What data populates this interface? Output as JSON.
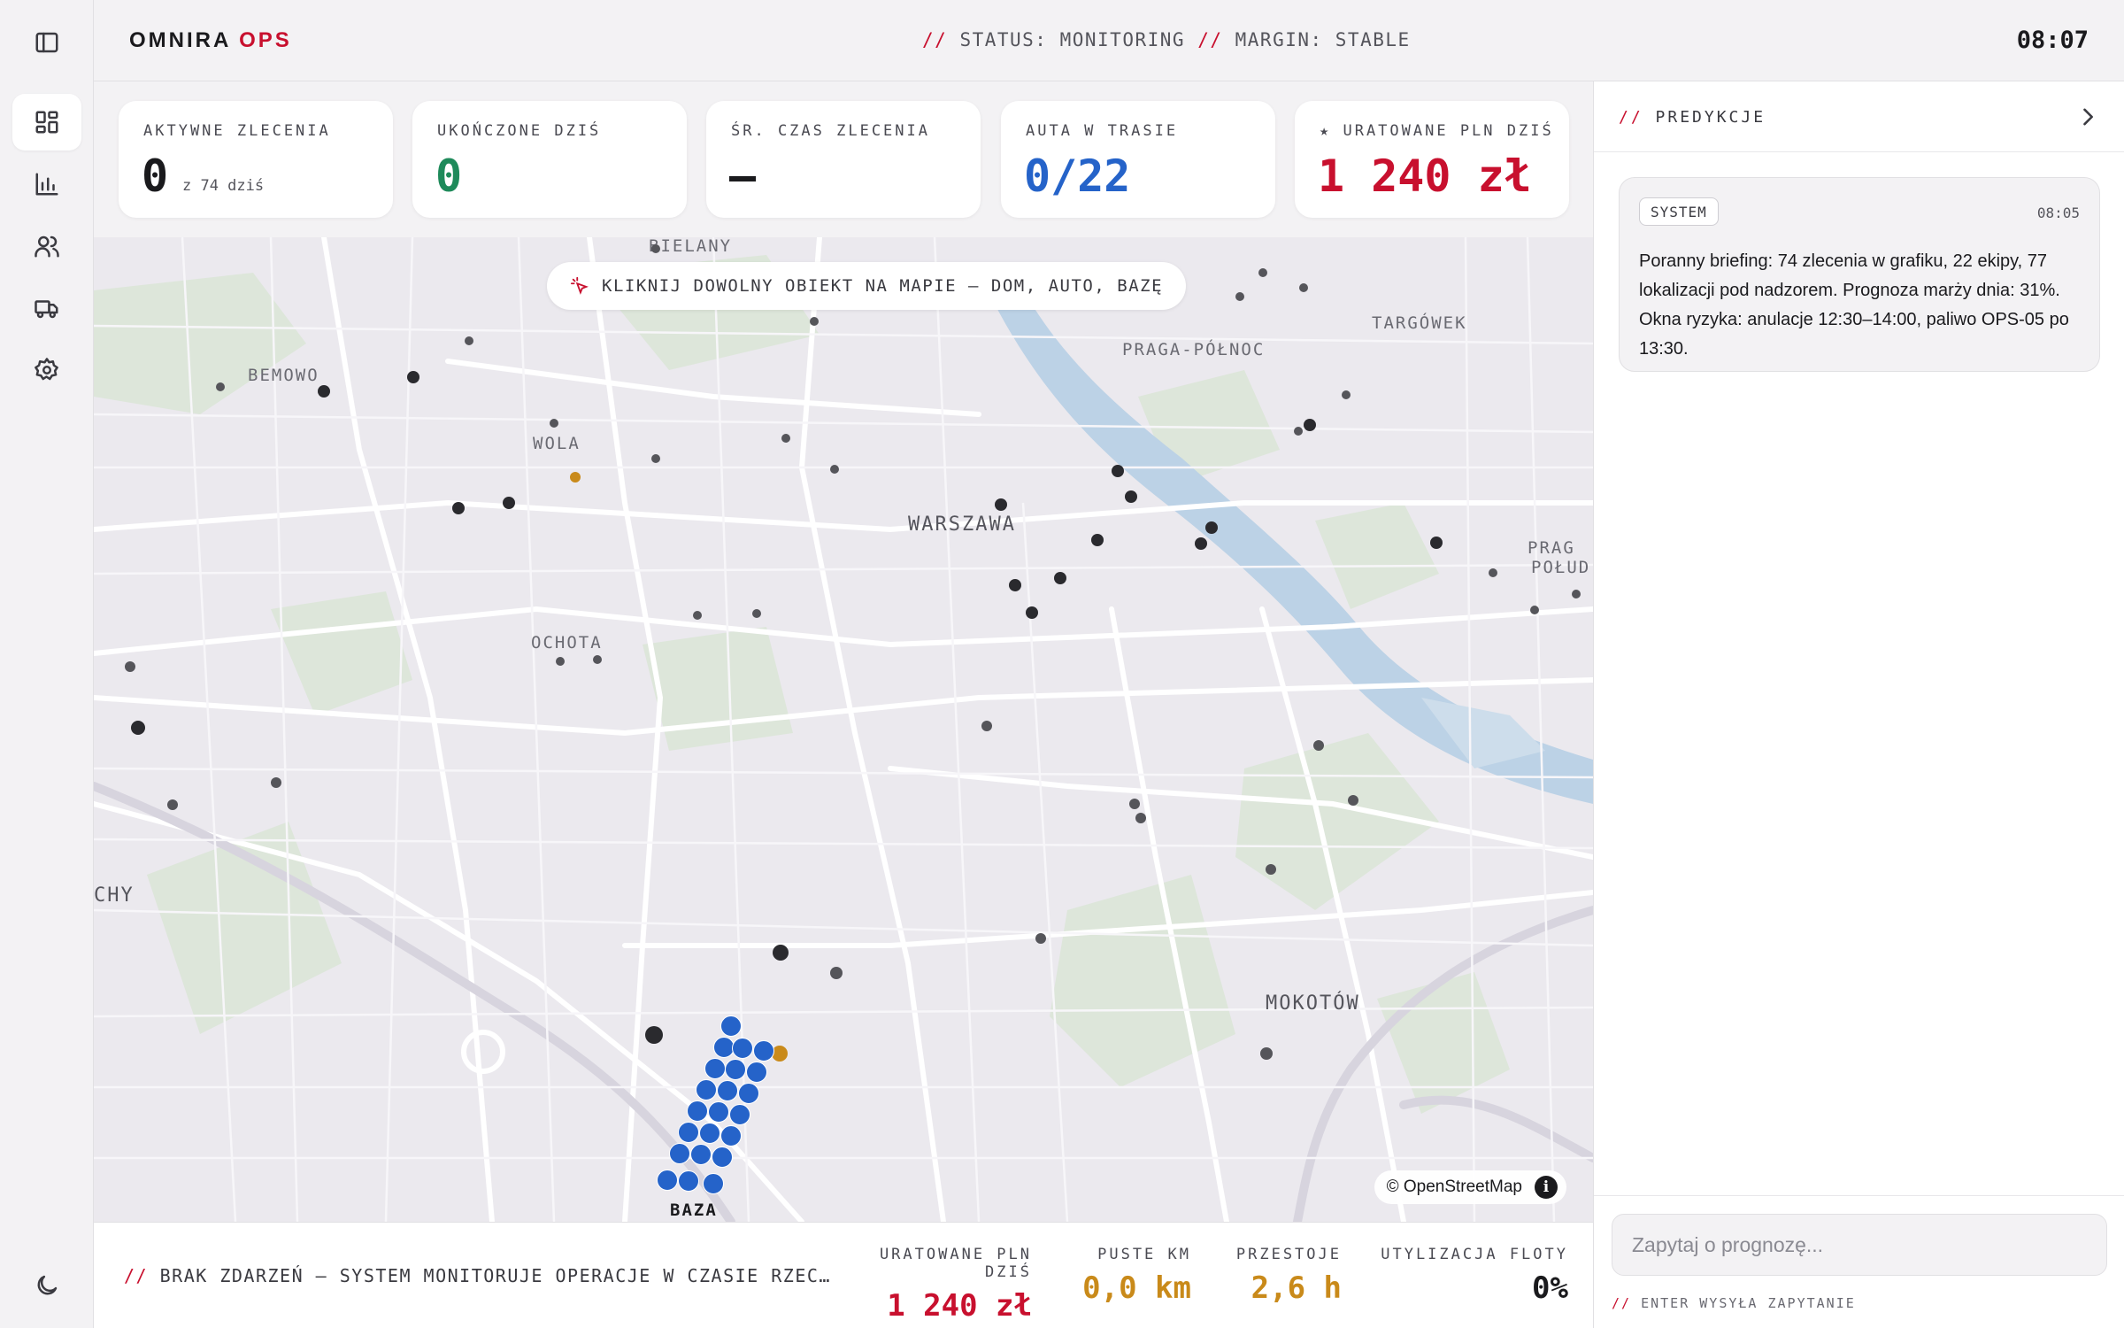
{
  "header": {
    "brand_primary": "OMNIRA",
    "brand_accent": "OPS",
    "status_slash": "//",
    "status_label": "STATUS: MONITORING",
    "margin_slash": "//",
    "margin_label": "MARGIN: STABLE",
    "clock": "08:07"
  },
  "sidebar": {
    "items": [
      {
        "icon": "panel-toggle-icon"
      },
      {
        "icon": "dashboard-icon",
        "active": true
      },
      {
        "icon": "bar-chart-icon"
      },
      {
        "icon": "users-icon"
      },
      {
        "icon": "truck-icon"
      },
      {
        "icon": "gear-icon"
      },
      {
        "icon": "moon-icon"
      }
    ]
  },
  "kpis": [
    {
      "label": "AKTYWNE ZLECENIA",
      "value": "0",
      "sub": "z 74 dziś",
      "color": "#1a1a1d"
    },
    {
      "label": "UKOŃCZONE DZIŚ",
      "value": "0",
      "color": "#1e8a5a"
    },
    {
      "label": "ŚR. CZAS ZLECENIA",
      "value": "—",
      "color": "#1a1a1d"
    },
    {
      "label": "AUTA W TRASIE",
      "value": "0/22",
      "color": "#2563c9"
    },
    {
      "label": "★ URATOWANE PLN DZIŚ",
      "value": "1 240 zł",
      "color": "#c8102e"
    }
  ],
  "map": {
    "hint": "KLIKNIJ DOWOLNY OBIEKT NA MAPIE — DOM, AUTO, BAZĘ",
    "places": {
      "bielany": "BIELANY",
      "bemowo": "BEMOWO",
      "wola": "WOLA",
      "ochota": "OCHOTA",
      "warszawa": "WARSZAWA",
      "praga_polnoc": "PRAGA-PÓŁNOC",
      "targowek": "TARGÓWEK",
      "praga_poludnie_1": "PRAG",
      "praga_poludnie_2": "POŁUD",
      "wlochy": "CHY",
      "mokotow": "MOKOTÓW",
      "baza": "BAZA"
    },
    "attribution": "© OpenStreetMap",
    "info_glyph": "i",
    "colors": {
      "vehicle": "#2563c9",
      "warning": "#c98a1a",
      "location": "#2a2a2e"
    }
  },
  "bottom": {
    "event_slash": "//",
    "event_text": "BRAK ZDARZEŃ — SYSTEM MONITORUJE OPERACJE W CZASIE RZEC…",
    "metrics": [
      {
        "label": "URATOWANE PLN DZIŚ",
        "value": "1 240 zł",
        "color": "#c8102e"
      },
      {
        "label": "PUSTE KM",
        "value": "0,0 km",
        "color": "#c98a1a"
      },
      {
        "label": "PRZESTOJE",
        "value": "2,6 h",
        "color": "#c98a1a"
      },
      {
        "label": "UTYLIZACJA FLOTY",
        "value": "0%",
        "color": "#1a1a1d"
      }
    ]
  },
  "panel": {
    "title_slash": "//",
    "title": "PREDYKCJE",
    "message": {
      "tag": "SYSTEM",
      "time": "08:05",
      "text": "Poranny briefing: 74 zlecenia w grafiku, 22 ekipy, 77 lokalizacji pod nadzorem. Prognoza marży dnia: 31%. Okna ryzyka: anulacje 12:30–14:00, paliwo OPS-05 po 13:30."
    },
    "input_placeholder": "Zapytaj o prognozę...",
    "input_hint_slash": "//",
    "input_hint": "ENTER WYSYŁA ZAPYTANIE"
  }
}
